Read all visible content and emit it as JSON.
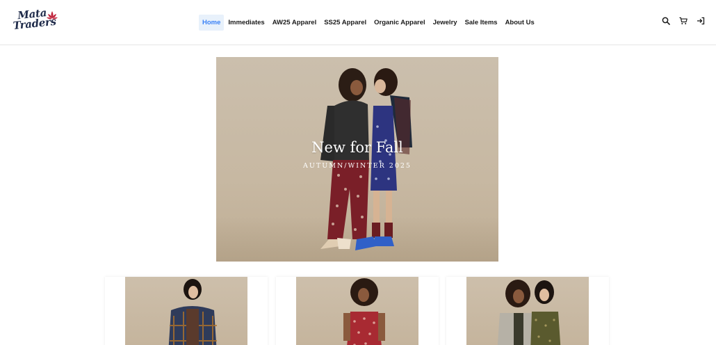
{
  "brand": {
    "logo_line1": "Mata",
    "logo_line2": "Traders",
    "logo_color": "#1f2b4a",
    "flower_color": "#c0233b"
  },
  "nav": {
    "items": [
      {
        "label": "Home",
        "active": true
      },
      {
        "label": "Immediates",
        "active": false
      },
      {
        "label": "AW25 Apparel",
        "active": false
      },
      {
        "label": "SS25 Apparel",
        "active": false
      },
      {
        "label": "Organic Apparel",
        "active": false
      },
      {
        "label": "Jewelry",
        "active": false
      },
      {
        "label": "Sale Items",
        "active": false
      },
      {
        "label": "About Us",
        "active": false
      }
    ],
    "active_color": "#3b82f6"
  },
  "header_icons": [
    "search-icon",
    "cart-icon",
    "sign-in-icon"
  ],
  "hero": {
    "title": "New for Fall",
    "subtitle": "AUTUMN/WINTER 2025"
  },
  "cards": [
    {
      "name": "product-card-plaid-jacket"
    },
    {
      "name": "product-card-red-dress"
    },
    {
      "name": "product-card-duo"
    }
  ]
}
